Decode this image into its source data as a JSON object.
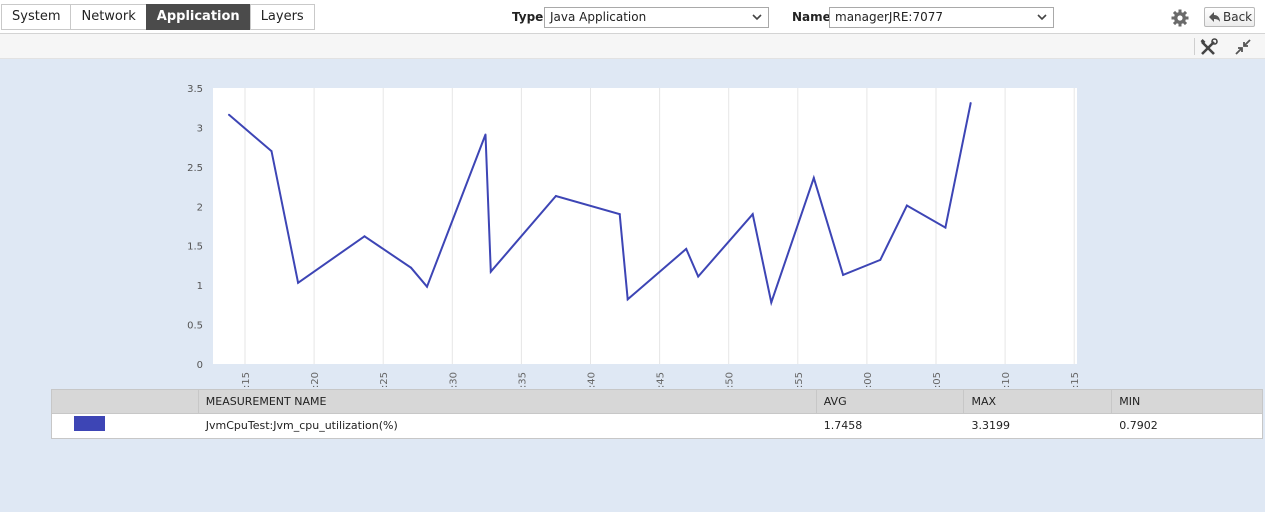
{
  "tabs": [
    {
      "label": "System",
      "active": false
    },
    {
      "label": "Network",
      "active": false
    },
    {
      "label": "Application",
      "active": true
    },
    {
      "label": "Layers",
      "active": false
    }
  ],
  "filters": {
    "type_label": "Type",
    "type_value": "Java Application",
    "name_label": "Name",
    "name_value": "managerJRE:7077"
  },
  "toolbar": {
    "settings_icon": "gear-icon",
    "back_label": "Back",
    "tools_icon": "tools-icon",
    "collapse_icon": "collapse-icon"
  },
  "colors": {
    "series": "#3d45b5",
    "background": "#dfe8f4"
  },
  "chart_data": {
    "type": "line",
    "title": "",
    "xlabel": "",
    "ylabel": "",
    "ylim": [
      0,
      3.5
    ],
    "yticks": [
      "0",
      "0.5",
      "1",
      "1.5",
      "2",
      "2.5",
      "3",
      "3.5"
    ],
    "xlim": [
      12.5,
      77.5
    ],
    "xticks": [
      ":15",
      ":20",
      ":25",
      ":30",
      ":35",
      ":40",
      ":45",
      ":50",
      ":55",
      ":00",
      ":05",
      ":10",
      ":15"
    ],
    "grid": true,
    "series": [
      {
        "color": "#3d45b5",
        "points": [
          {
            "x": 13.7,
            "y": 3.16
          },
          {
            "x": 16.9,
            "y": 2.7
          },
          {
            "x": 18.9,
            "y": 1.03
          },
          {
            "x": 23.9,
            "y": 1.62
          },
          {
            "x": 27.4,
            "y": 1.22
          },
          {
            "x": 28.6,
            "y": 0.98
          },
          {
            "x": 33.0,
            "y": 2.91
          },
          {
            "x": 33.4,
            "y": 1.17
          },
          {
            "x": 38.3,
            "y": 2.13
          },
          {
            "x": 43.1,
            "y": 1.9
          },
          {
            "x": 43.7,
            "y": 0.82
          },
          {
            "x": 48.1,
            "y": 1.46
          },
          {
            "x": 49.0,
            "y": 1.11
          },
          {
            "x": 53.1,
            "y": 1.9
          },
          {
            "x": 54.5,
            "y": 0.78
          },
          {
            "x": 57.7,
            "y": 2.36
          },
          {
            "x": 59.9,
            "y": 1.13
          },
          {
            "x": 62.7,
            "y": 1.32
          },
          {
            "x": 64.7,
            "y": 2.01
          },
          {
            "x": 67.6,
            "y": 1.73
          },
          {
            "x": 69.5,
            "y": 3.31
          }
        ]
      }
    ]
  },
  "table": {
    "headers": [
      "",
      "MEASUREMENT NAME",
      "AVG",
      "MAX",
      "MIN"
    ],
    "rows": [
      {
        "name": "JvmCpuTest:Jvm_cpu_utilization(%)",
        "avg": "1.7458",
        "max": "3.3199",
        "min": "0.7902"
      }
    ]
  }
}
